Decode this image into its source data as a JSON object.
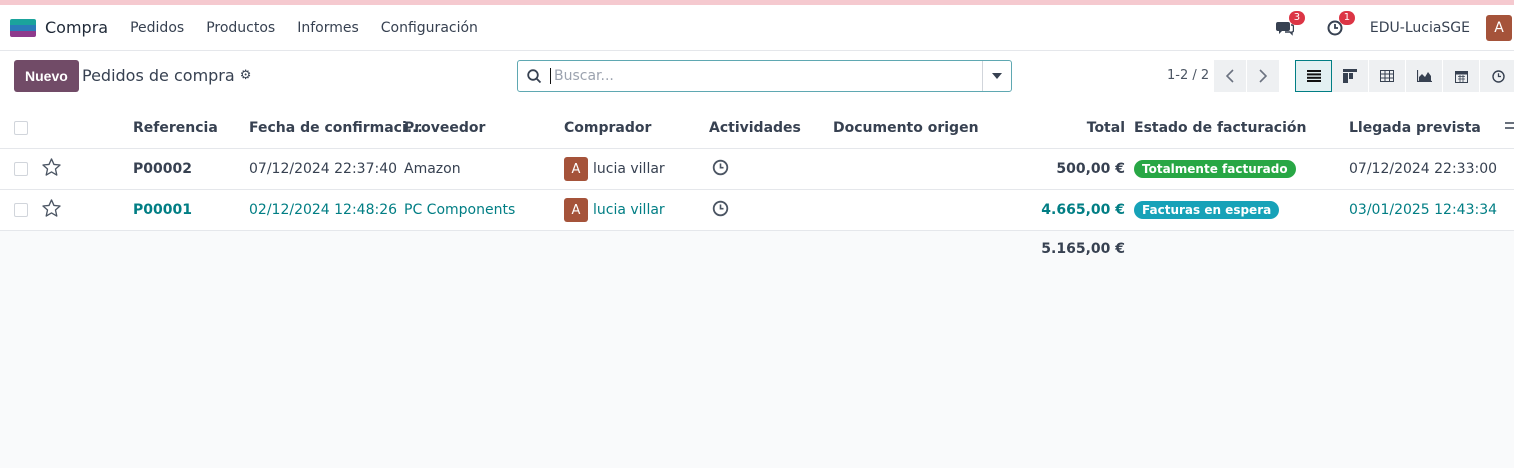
{
  "navbar": {
    "app_name": "Compra",
    "menu": [
      "Pedidos",
      "Productos",
      "Informes",
      "Configuración"
    ],
    "messages_badge": "3",
    "activities_badge": "1",
    "company": "EDU-LuciaSGE",
    "user_initial": "A"
  },
  "control": {
    "new_label": "Nuevo",
    "title": "Pedidos de compra",
    "search_placeholder": "Buscar...",
    "pager": "1-2 / 2"
  },
  "table": {
    "headers": {
      "reference": "Referencia",
      "confirm_date": "Fecha de confirmaci...",
      "vendor": "Proveedor",
      "buyer": "Comprador",
      "activities": "Actividades",
      "source_doc": "Documento origen",
      "total": "Total",
      "invoice_status": "Estado de facturación",
      "expected_arrival": "Llegada prevista"
    },
    "rows": [
      {
        "reference": "P00002",
        "confirm_date": "07/12/2024 22:37:40",
        "vendor": "Amazon",
        "buyer_initial": "A",
        "buyer": "lucia villar",
        "total": "500,00 €",
        "invoice_status": "Totalmente facturado",
        "expected_arrival": "07/12/2024 22:33:00"
      },
      {
        "reference": "P00001",
        "confirm_date": "02/12/2024 12:48:26",
        "vendor": "PC Components",
        "buyer_initial": "A",
        "buyer": "lucia villar",
        "total": "4.665,00 €",
        "invoice_status": "Facturas en espera",
        "expected_arrival": "03/01/2025 12:43:34"
      }
    ],
    "sum_total": "5.165,00 €"
  },
  "colors": {
    "brand": "#714b67",
    "teal": "#017e84",
    "status_invoiced": "#28a745",
    "status_waiting": "#17a2b8"
  }
}
